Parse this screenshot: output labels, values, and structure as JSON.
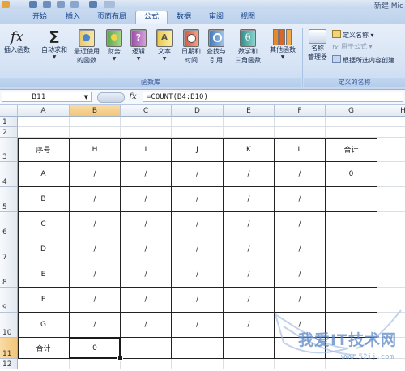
{
  "window": {
    "title": "新建 Mic"
  },
  "tabs": [
    {
      "label": "开始",
      "active": false
    },
    {
      "label": "插入",
      "active": false
    },
    {
      "label": "页面布局",
      "active": false
    },
    {
      "label": "公式",
      "active": true
    },
    {
      "label": "数据",
      "active": false
    },
    {
      "label": "审阅",
      "active": false
    },
    {
      "label": "视图",
      "active": false
    }
  ],
  "ribbon": {
    "function_library": {
      "group_label": "函数库",
      "buttons": [
        {
          "label1": "插入函数",
          "label2": "",
          "icon": "fx-icon"
        },
        {
          "label1": "自动求和",
          "label2": "",
          "icon": "sigma-icon"
        },
        {
          "label1": "最近使用",
          "label2": "的函数",
          "icon": "recent-book-icon"
        },
        {
          "label1": "财务",
          "label2": "",
          "icon": "finance-book-icon"
        },
        {
          "label1": "逻辑",
          "label2": "",
          "icon": "logic-book-icon"
        },
        {
          "label1": "文本",
          "label2": "",
          "icon": "text-book-icon"
        },
        {
          "label1": "日期和",
          "label2": "时间",
          "icon": "datetime-book-icon"
        },
        {
          "label1": "查找与",
          "label2": "引用",
          "icon": "lookup-book-icon"
        },
        {
          "label1": "数学和",
          "label2": "三角函数",
          "icon": "math-book-icon"
        },
        {
          "label1": "其他函数",
          "label2": "",
          "icon": "more-books-icon"
        }
      ]
    },
    "defined_names": {
      "group_label": "定义的名称",
      "name_manager_1": "名称",
      "name_manager_2": "管理器",
      "define_name": "定义名称",
      "use_in_formula": "用于公式",
      "create_from_selection": "根据所选内容创建"
    }
  },
  "formula_bar": {
    "name_box": "B11",
    "fx": "fx",
    "formula": "=COUNT(B4:B10)"
  },
  "sheet": {
    "columns": [
      "A",
      "B",
      "C",
      "D",
      "E",
      "F",
      "G",
      "H"
    ],
    "rows": [
      "1",
      "2",
      "3",
      "4",
      "5",
      "6",
      "7",
      "8",
      "9",
      "10",
      "11",
      "12"
    ],
    "table": {
      "header": [
        "序号",
        "H",
        "I",
        "J",
        "K",
        "L",
        "合计"
      ],
      "body": [
        [
          "A",
          "/",
          "/",
          "/",
          "/",
          "/",
          "0"
        ],
        [
          "B",
          "/",
          "/",
          "/",
          "/",
          "/",
          ""
        ],
        [
          "C",
          "/",
          "/",
          "/",
          "/",
          "/",
          ""
        ],
        [
          "D",
          "/",
          "/",
          "/",
          "/",
          "/",
          ""
        ],
        [
          "E",
          "/",
          "/",
          "/",
          "/",
          "/",
          ""
        ],
        [
          "F",
          "/",
          "/",
          "/",
          "/",
          "/",
          ""
        ],
        [
          "G",
          "/",
          "/",
          "/",
          "/",
          "/",
          ""
        ],
        [
          "合计",
          "0",
          "",
          "",
          "",
          "",
          ""
        ]
      ]
    },
    "selected_cell": "B11"
  },
  "watermark": {
    "text": "我爱IT技术网",
    "url": "www.52ij.com"
  },
  "colors": {
    "ribbon_tab_text": "#15428b",
    "selected_header": "#f3c578",
    "grid_line": "#dadfe6"
  }
}
